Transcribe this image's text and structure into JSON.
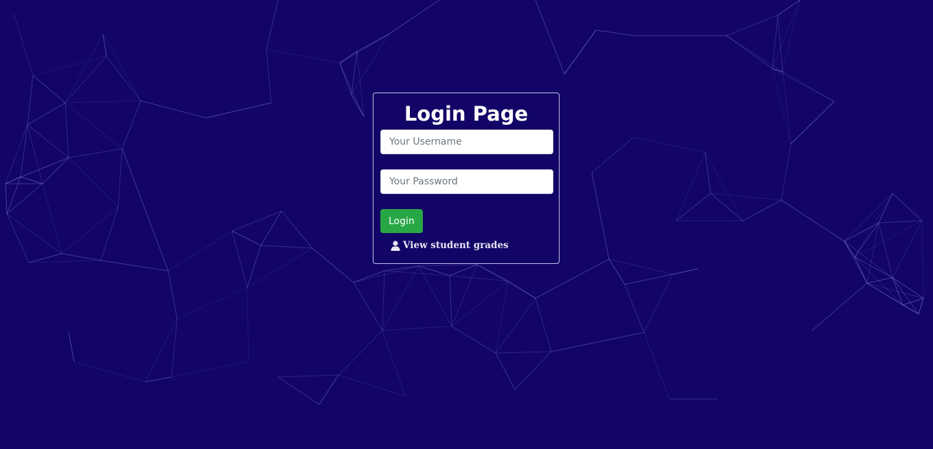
{
  "login": {
    "title": "Login Page",
    "username_placeholder": "Your Username",
    "password_placeholder": "Your Password",
    "login_label": "Login",
    "grades_link_label": "View student grades",
    "grades_link_icon": "user-icon"
  },
  "colors": {
    "background": "#120567",
    "network_lines": "#9d93e6",
    "login_button": "#28a745"
  }
}
